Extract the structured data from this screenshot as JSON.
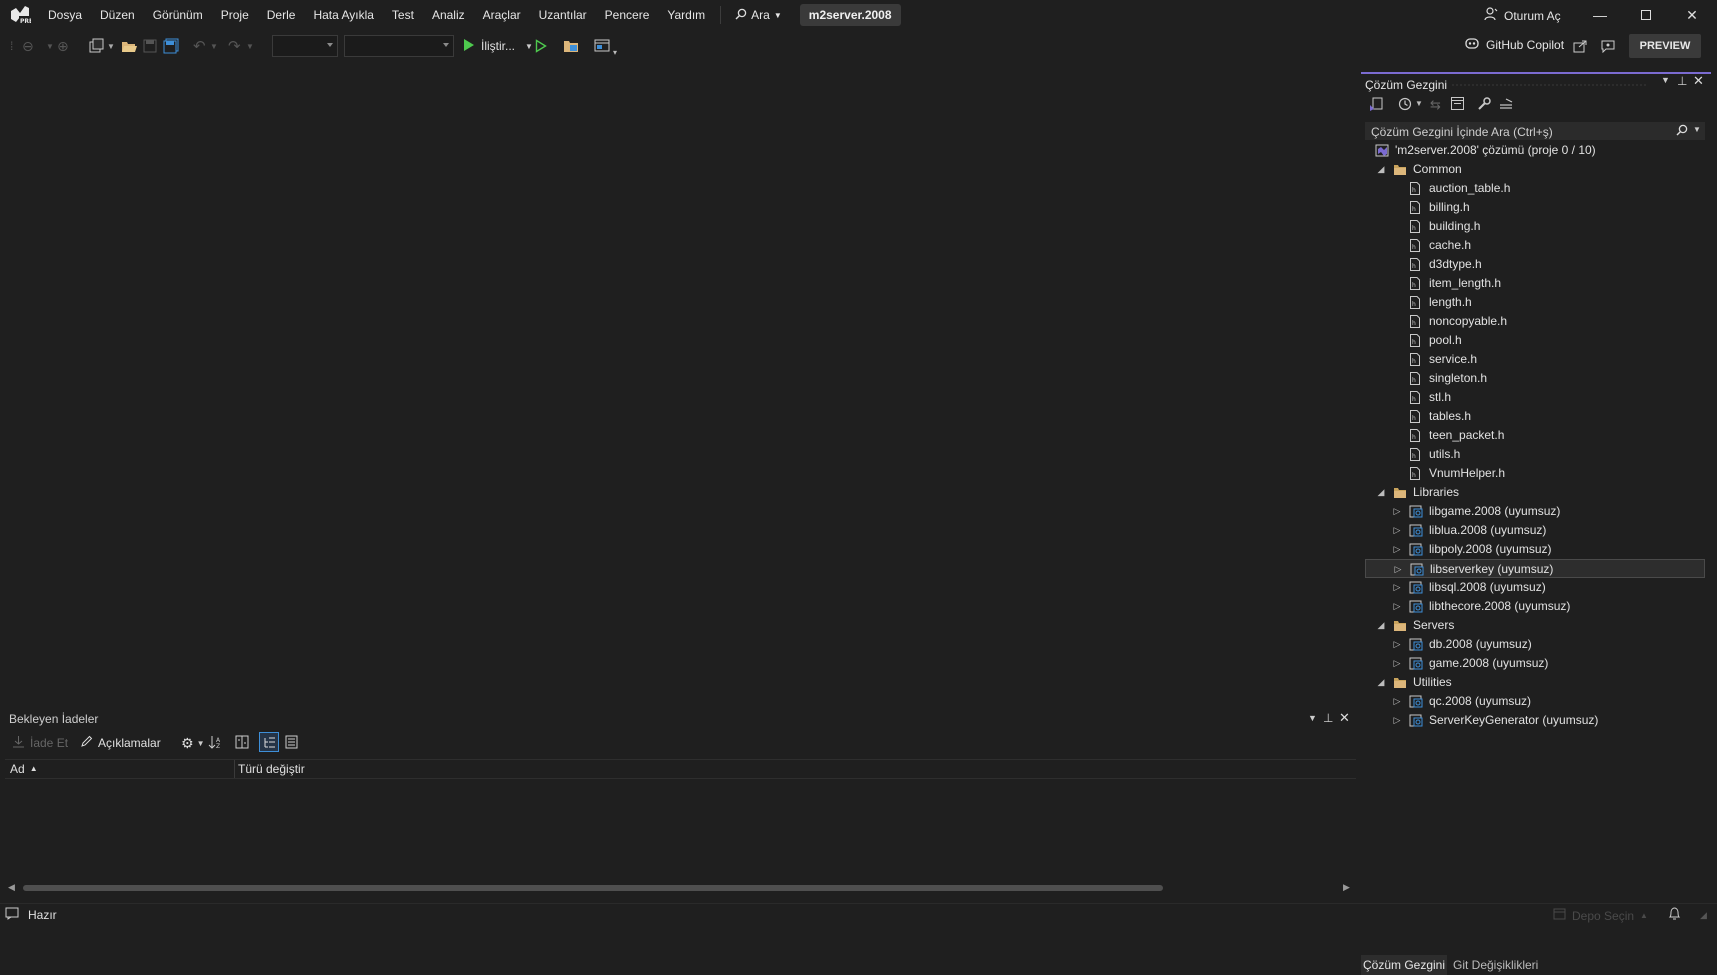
{
  "menu": {
    "items": [
      "Dosya",
      "Düzen",
      "Görünüm",
      "Proje",
      "Derle",
      "Hata Ayıkla",
      "Test",
      "Analiz",
      "Araçlar",
      "Uzantılar",
      "Pencere",
      "Yardım"
    ],
    "search_label": "Ara",
    "solution_name": "m2server.2008",
    "sign_in": "Oturum Aç"
  },
  "toolbar": {
    "run_label": "İliştir...",
    "copilot_label": "GitHub Copilot",
    "preview_label": "PREVIEW"
  },
  "solution_explorer": {
    "title": "Çözüm Gezgini",
    "search_placeholder": "Çözüm Gezgini İçinde Ara (Ctrl+ş)",
    "tree": [
      {
        "label": "'m2server.2008' çözümü (proje 0 / 10)",
        "level": 0,
        "kind": "solution",
        "twisty": "none"
      },
      {
        "label": "Common",
        "level": 1,
        "kind": "folder",
        "twisty": "expanded"
      },
      {
        "label": "auction_table.h",
        "level": 2,
        "kind": "file",
        "twisty": "none"
      },
      {
        "label": "billing.h",
        "level": 2,
        "kind": "file",
        "twisty": "none"
      },
      {
        "label": "building.h",
        "level": 2,
        "kind": "file",
        "twisty": "none"
      },
      {
        "label": "cache.h",
        "level": 2,
        "kind": "file",
        "twisty": "none"
      },
      {
        "label": "d3dtype.h",
        "level": 2,
        "kind": "file",
        "twisty": "none"
      },
      {
        "label": "item_length.h",
        "level": 2,
        "kind": "file",
        "twisty": "none"
      },
      {
        "label": "length.h",
        "level": 2,
        "kind": "file",
        "twisty": "none"
      },
      {
        "label": "noncopyable.h",
        "level": 2,
        "kind": "file",
        "twisty": "none"
      },
      {
        "label": "pool.h",
        "level": 2,
        "kind": "file",
        "twisty": "none"
      },
      {
        "label": "service.h",
        "level": 2,
        "kind": "file",
        "twisty": "none"
      },
      {
        "label": "singleton.h",
        "level": 2,
        "kind": "file",
        "twisty": "none"
      },
      {
        "label": "stl.h",
        "level": 2,
        "kind": "file",
        "twisty": "none"
      },
      {
        "label": "tables.h",
        "level": 2,
        "kind": "file",
        "twisty": "none"
      },
      {
        "label": "teen_packet.h",
        "level": 2,
        "kind": "file",
        "twisty": "none"
      },
      {
        "label": "utils.h",
        "level": 2,
        "kind": "file",
        "twisty": "none"
      },
      {
        "label": "VnumHelper.h",
        "level": 2,
        "kind": "file",
        "twisty": "none"
      },
      {
        "label": "Libraries",
        "level": 1,
        "kind": "folder",
        "twisty": "expanded"
      },
      {
        "label": "libgame.2008 (uyumsuz)",
        "level": 2,
        "kind": "project",
        "twisty": "collapsed"
      },
      {
        "label": "liblua.2008 (uyumsuz)",
        "level": 2,
        "kind": "project",
        "twisty": "collapsed"
      },
      {
        "label": "libpoly.2008 (uyumsuz)",
        "level": 2,
        "kind": "project",
        "twisty": "collapsed"
      },
      {
        "label": "libserverkey (uyumsuz)",
        "level": 2,
        "kind": "project",
        "twisty": "collapsed",
        "selected": true
      },
      {
        "label": "libsql.2008 (uyumsuz)",
        "level": 2,
        "kind": "project",
        "twisty": "collapsed"
      },
      {
        "label": "libthecore.2008 (uyumsuz)",
        "level": 2,
        "kind": "project",
        "twisty": "collapsed"
      },
      {
        "label": "Servers",
        "level": 1,
        "kind": "folder",
        "twisty": "expanded"
      },
      {
        "label": "db.2008 (uyumsuz)",
        "level": 2,
        "kind": "project",
        "twisty": "collapsed"
      },
      {
        "label": "game.2008 (uyumsuz)",
        "level": 2,
        "kind": "project",
        "twisty": "collapsed"
      },
      {
        "label": "Utilities",
        "level": 1,
        "kind": "folder",
        "twisty": "expanded"
      },
      {
        "label": "qc.2008 (uyumsuz)",
        "level": 2,
        "kind": "project",
        "twisty": "collapsed"
      },
      {
        "label": "ServerKeyGenerator (uyumsuz)",
        "level": 2,
        "kind": "project",
        "twisty": "collapsed"
      }
    ],
    "tabs": [
      "Çözüm Gezgini",
      "Git Değişiklikleri"
    ]
  },
  "pending": {
    "title": "Bekleyen İadeler",
    "checkin_label": "İade Et",
    "comments_label": "Açıklamalar",
    "columns": [
      "Ad",
      "Türü değiştir"
    ]
  },
  "status": {
    "text": "Hazır",
    "repo_label": "Depo Seçin"
  },
  "colors": {
    "accent": "#7b6bd1",
    "background": "#1f1f1f",
    "run_green": "#4ec94e"
  }
}
